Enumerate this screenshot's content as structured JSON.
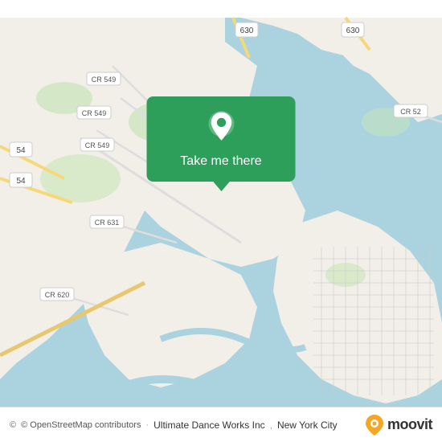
{
  "map": {
    "alt": "Map of New York City area showing coastal region",
    "center_lat": 40.58,
    "center_lng": -74.12
  },
  "popup": {
    "button_label": "Take me there"
  },
  "bottom_bar": {
    "copyright_text": "© OpenStreetMap contributors",
    "location_name": "Ultimate Dance Works Inc",
    "city_name": "New York City"
  },
  "moovit": {
    "logo_text": "moovit"
  },
  "road_labels": [
    "CR 549",
    "CR 549",
    "CR 549",
    "CR 631",
    "CR 620",
    "CR 52",
    "630",
    "630",
    "54",
    "54"
  ]
}
